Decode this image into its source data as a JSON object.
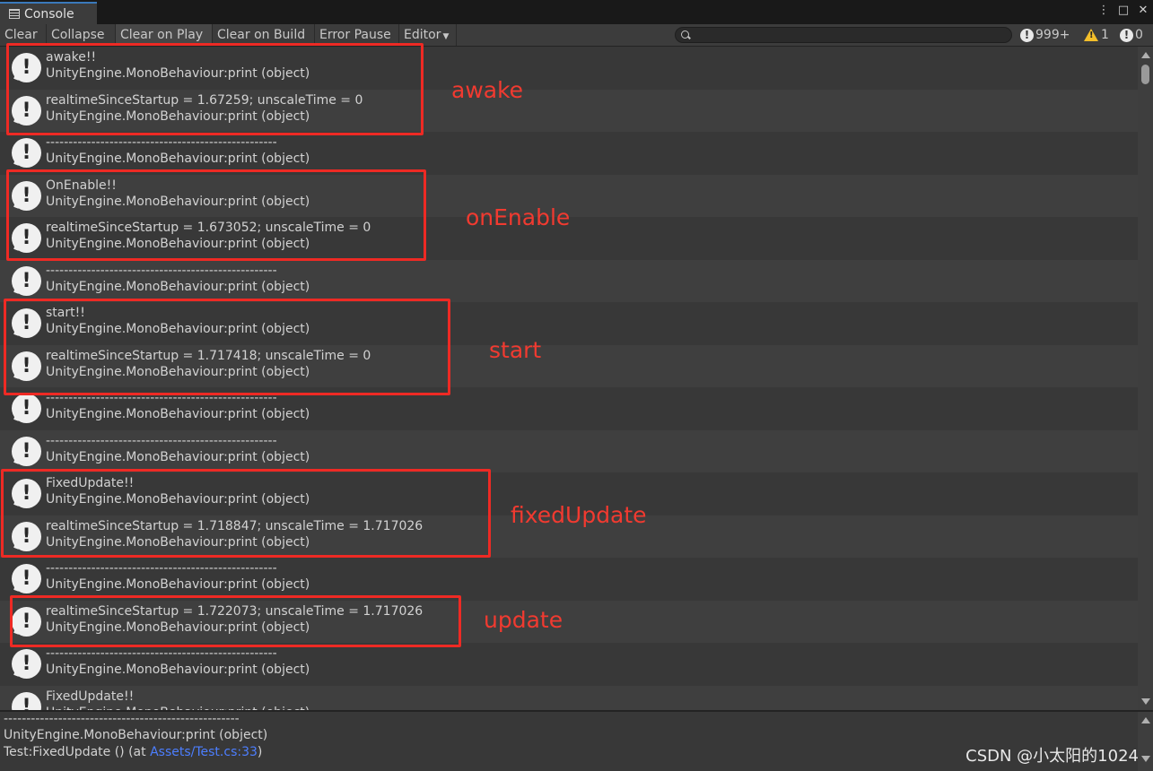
{
  "tab": {
    "title": "Console",
    "icon": "console-icon"
  },
  "window_buttons": {
    "menu": "⋮",
    "maximize": "□",
    "close": "✕"
  },
  "toolbar": {
    "clear": "Clear",
    "collapse": "Collapse",
    "clear_on_play": "Clear on Play",
    "clear_on_build": "Clear on Build",
    "error_pause": "Error Pause",
    "editor": "Editor",
    "search_placeholder": "",
    "info_count": "999+",
    "warning_count": "1",
    "error_count": "0"
  },
  "entries": [
    {
      "line1": "awake!!",
      "line2": "UnityEngine.MonoBehaviour:print (object)"
    },
    {
      "line1": "realtimeSinceStartup = 1.67259; unscaleTime = 0",
      "line2": "UnityEngine.MonoBehaviour:print (object)"
    },
    {
      "line1": "---------------------------------------------------",
      "line2": "UnityEngine.MonoBehaviour:print (object)"
    },
    {
      "line1": "OnEnable!!",
      "line2": "UnityEngine.MonoBehaviour:print (object)"
    },
    {
      "line1": "realtimeSinceStartup = 1.673052; unscaleTime = 0",
      "line2": "UnityEngine.MonoBehaviour:print (object)"
    },
    {
      "line1": "---------------------------------------------------",
      "line2": "UnityEngine.MonoBehaviour:print (object)"
    },
    {
      "line1": "start!!",
      "line2": "UnityEngine.MonoBehaviour:print (object)"
    },
    {
      "line1": "realtimeSinceStartup = 1.717418; unscaleTime = 0",
      "line2": "UnityEngine.MonoBehaviour:print (object)"
    },
    {
      "line1": "---------------------------------------------------",
      "line2": "UnityEngine.MonoBehaviour:print (object)"
    },
    {
      "line1": "---------------------------------------------------",
      "line2": "UnityEngine.MonoBehaviour:print (object)"
    },
    {
      "line1": "FixedUpdate!!",
      "line2": "UnityEngine.MonoBehaviour:print (object)"
    },
    {
      "line1": "realtimeSinceStartup = 1.718847; unscaleTime = 1.717026",
      "line2": "UnityEngine.MonoBehaviour:print (object)"
    },
    {
      "line1": "---------------------------------------------------",
      "line2": "UnityEngine.MonoBehaviour:print (object)"
    },
    {
      "line1": "realtimeSinceStartup = 1.722073; unscaleTime = 1.717026",
      "line2": "UnityEngine.MonoBehaviour:print (object)"
    },
    {
      "line1": "---------------------------------------------------",
      "line2": "UnityEngine.MonoBehaviour:print (object)"
    },
    {
      "line1": "FixedUpdate!!",
      "line2": "UnityEngine.MonoBehaviour:print (object)"
    }
  ],
  "detail": {
    "line1": "----------------------------------------------------",
    "line2": "UnityEngine.MonoBehaviour:print (object)",
    "line3_prefix": "Test:FixedUpdate () (at ",
    "line3_link": "Assets/Test.cs:33",
    "line3_suffix": ")"
  },
  "annotations": {
    "awake": "awake",
    "onEnable": "onEnable",
    "start": "start",
    "fixedUpdate": "fixedUpdate",
    "update": "update"
  },
  "watermark": "CSDN @小太阳的1024",
  "colors": {
    "annotation": "#ee2a24",
    "link": "#4c7eff",
    "warning": "#f4bf2a",
    "tab_accent": "#3a79bb"
  }
}
